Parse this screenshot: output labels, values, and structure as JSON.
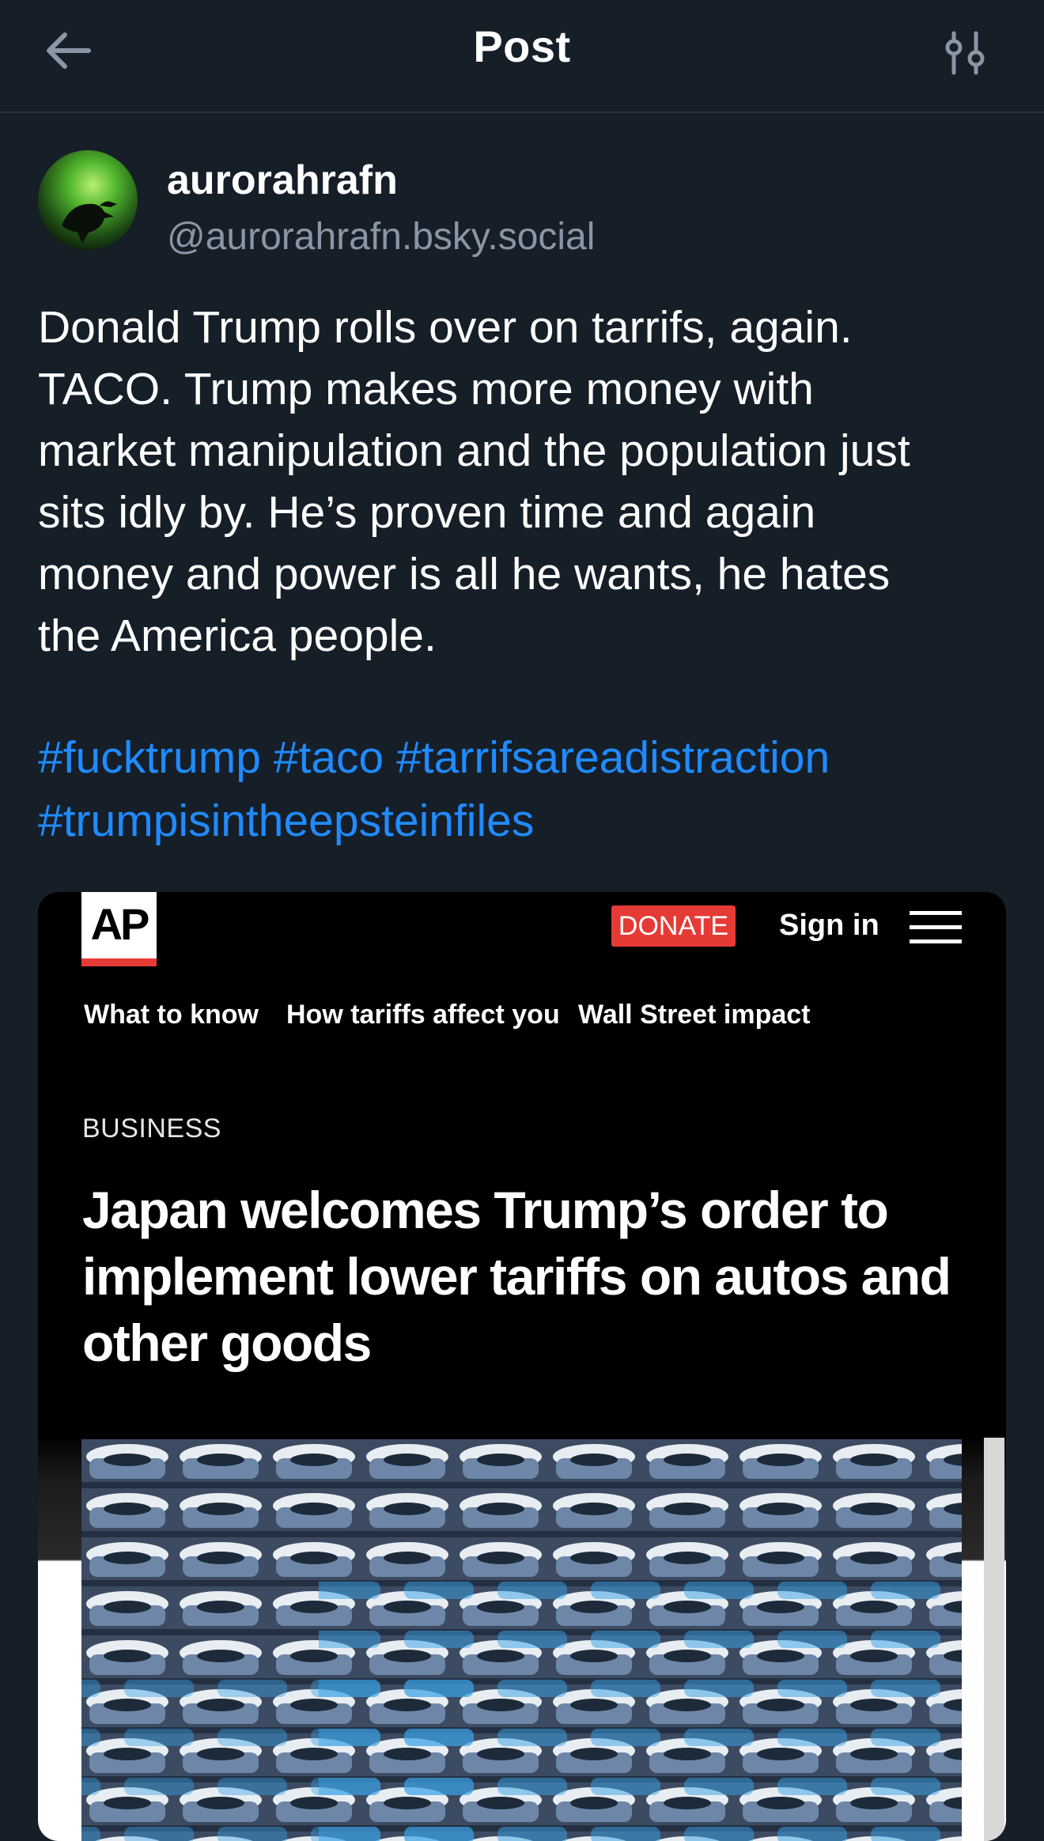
{
  "header": {
    "title": "Post"
  },
  "author": {
    "display_name": "aurorahrafn",
    "handle": "@aurorahrafn.bsky.social"
  },
  "post": {
    "text": "Donald Trump rolls over on tarrifs, again.\nTACO. Trump makes more money with\nmarket manipulation and the population just\nsits idly by. He’s proven time and again\nmoney and power is all he wants, he hates\nthe America people.",
    "hashtags": [
      "#fucktrump",
      "#taco",
      "#tarrifsareadistraction",
      "#trumpisintheepsteinfiles"
    ]
  },
  "embed": {
    "logo": "AP",
    "donate_label": "DONATE",
    "signin_label": "Sign in",
    "nav_links": [
      "What to know",
      "How tariffs affect you",
      "Wall Street impact"
    ],
    "section": "BUSINESS",
    "headline": "Japan welcomes Trump’s order to implement lower tariffs on autos and other goods"
  },
  "colors": {
    "background": "#161e27",
    "hashtag": "#1f8bff",
    "donate": "#e63a36"
  }
}
